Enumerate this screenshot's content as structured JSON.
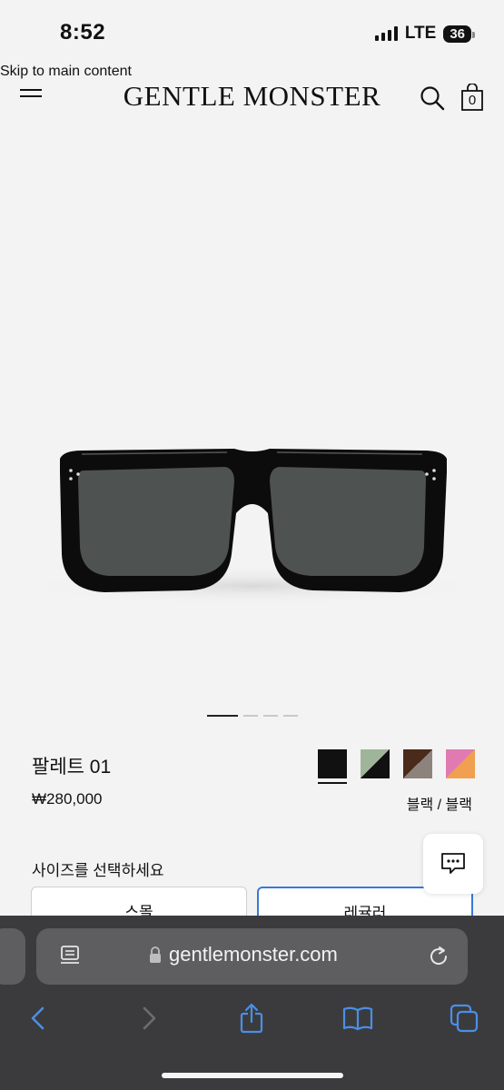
{
  "status_bar": {
    "time": "8:52",
    "network": "LTE",
    "battery": "36"
  },
  "skip_link": "Skip to main content",
  "header": {
    "brand": "GENTLE MONSTER",
    "cart_count": "0"
  },
  "product": {
    "name": "팔레트 01",
    "price": "₩280,000",
    "color_label": "블랙 / 블랙",
    "swatches": [
      {
        "name": "black",
        "colors": [
          "#111111",
          "#111111"
        ],
        "selected": true
      },
      {
        "name": "green-black",
        "colors": [
          "#9fb59a",
          "#111111"
        ],
        "selected": false
      },
      {
        "name": "brown-grey",
        "colors": [
          "#4a2a1a",
          "#8c847c"
        ],
        "selected": false
      },
      {
        "name": "pink-orange",
        "colors": [
          "#e07ab0",
          "#f0a050"
        ],
        "selected": false
      }
    ],
    "image_slides": 4,
    "active_slide": 1
  },
  "size": {
    "label": "사이즈를 선택하세요",
    "options": [
      "스몰",
      "레귤러"
    ],
    "selected": "레귤러"
  },
  "browser": {
    "url": "gentlemonster.com",
    "accent_color": "#4a8fe8"
  },
  "icons": [
    "menu-icon",
    "search-icon",
    "bag-icon",
    "chat-icon",
    "reader-icon",
    "lock-icon",
    "reload-icon",
    "back-icon",
    "forward-icon",
    "share-icon",
    "bookmarks-icon",
    "tabs-icon"
  ]
}
